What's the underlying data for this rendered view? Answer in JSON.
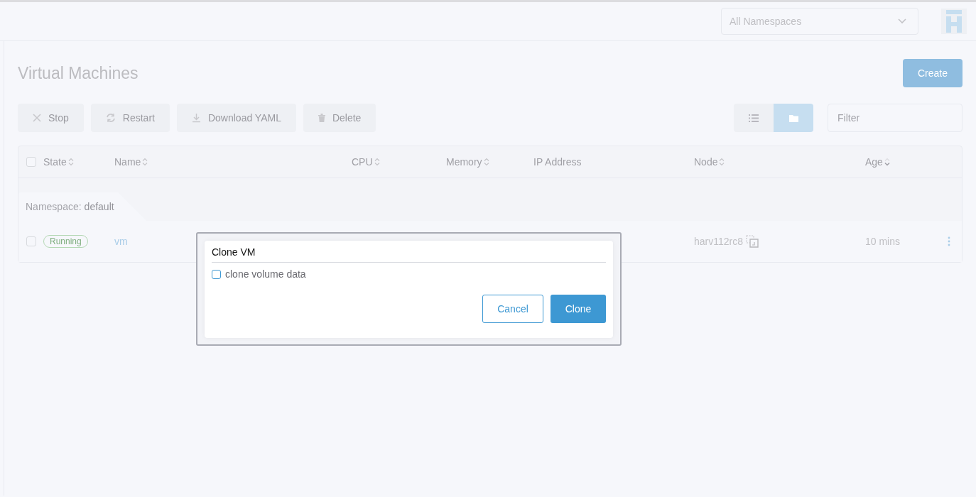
{
  "header": {
    "namespace_select": "All Namespaces"
  },
  "page": {
    "title": "Virtual Machines",
    "create_button": "Create"
  },
  "toolbar": {
    "actions": [
      {
        "kind": "stop",
        "label": "Stop"
      },
      {
        "kind": "restart",
        "label": "Restart"
      },
      {
        "kind": "download",
        "label": "Download YAML"
      },
      {
        "kind": "delete",
        "label": "Delete"
      }
    ],
    "view_modes": [
      {
        "kind": "list",
        "selected": false
      },
      {
        "kind": "folder",
        "selected": true
      }
    ],
    "filter": {
      "placeholder": "Filter"
    }
  },
  "table": {
    "all_selected": false,
    "columns": [
      {
        "label": "State",
        "sortable": true,
        "descending": false
      },
      {
        "label": "Name",
        "sortable": true,
        "descending": false
      },
      {
        "label": "CPU",
        "sortable": true,
        "descending": false
      },
      {
        "label": "Memory",
        "sortable": true,
        "descending": false
      },
      {
        "label": "IP Address",
        "sortable": false
      },
      {
        "label": "Node",
        "sortable": true,
        "descending": false
      },
      {
        "label": "Age",
        "sortable": true,
        "descending": true
      }
    ],
    "groups": [
      {
        "label": "Namespace:",
        "name": "default",
        "rows": [
          {
            "checked": false,
            "state": "Running",
            "name": "vm",
            "node": "harv112rc8",
            "age": "10 mins"
          }
        ]
      }
    ]
  },
  "dialog": {
    "title": "Clone VM",
    "checkbox": {
      "label": "clone volume data",
      "checked": false
    },
    "buttons": [
      {
        "label": "Cancel",
        "kind": "secondary"
      },
      {
        "label": "Clone",
        "kind": "primary"
      }
    ]
  }
}
